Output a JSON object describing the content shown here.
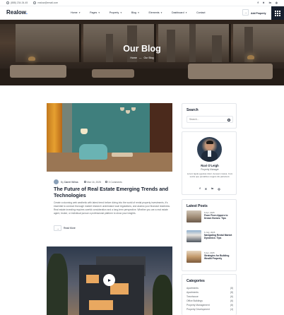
{
  "topbar": {
    "phone": "(888) 234-34-45",
    "email": "realow@email.com",
    "socials": [
      "f",
      "✕",
      "in",
      "◎"
    ]
  },
  "header": {
    "logo": "Realow",
    "logo_dot": ".",
    "nav": [
      {
        "label": "Home",
        "has_dropdown": true
      },
      {
        "label": "Pages",
        "has_dropdown": true
      },
      {
        "label": "Property",
        "has_dropdown": true
      },
      {
        "label": "Blog",
        "has_dropdown": true
      },
      {
        "label": "Elements",
        "has_dropdown": true
      },
      {
        "label": "Dashboard",
        "has_dropdown": true
      },
      {
        "label": "Contact",
        "has_dropdown": false
      }
    ],
    "login_icon": "→",
    "add_property": "Add Property"
  },
  "hero": {
    "title": "Our Blog",
    "crumb_home": "Home",
    "crumb_sep": "—",
    "crumb_current": "Our Blog"
  },
  "post": {
    "by": "By",
    "author": "Darrel Wilma",
    "date": "Mar 16, 2025",
    "comments": "3 Comments",
    "title": "The Future of Real Estate Emerging Trends and Technologies",
    "excerpt": "Create a stunning web aesthetic with latest trend before diving into the world of rental property investments, it's essential to conduct thorough market research understand local regulations, and assess your financial readiness. Real estate investing requires careful consideration and a long-term perspective. Whether you are a real estate agent, broker, or individual pursue a professional platform to show your insights.",
    "read_more": "Read More",
    "read_more_icon": "→"
  },
  "sidebar": {
    "search_title": "Search",
    "search_placeholder": "Search...",
    "profile_name": "Ravi O'Leigh",
    "profile_role": "Property Manager",
    "profile_bio": "Lorem ligula egestas dolor. Aenean massa. Cum sociis que penatibus magnis dis parturient.",
    "profile_socials": [
      "f",
      "✕",
      "in",
      "◎"
    ],
    "recent_title": "Latest Posts",
    "recent_posts": [
      {
        "date": "6 Apr, 2025",
        "title": "From Fixer-Uppers to Dream Homes: Tips"
      },
      {
        "date": "6 July, 2025",
        "title": "Navigating Rental Market Dynamics: Tips"
      },
      {
        "date": "6 Apr, 2025",
        "title": "Strategies for Building Wealth Property"
      }
    ],
    "categories_title": "Categories",
    "categories": [
      {
        "label": "Apartments",
        "count": "(8)"
      },
      {
        "label": "Apartments",
        "count": "(8)"
      },
      {
        "label": "Townhouse",
        "count": "(6)"
      },
      {
        "label": "Office Buildings",
        "count": "(6)"
      },
      {
        "label": "Property Management",
        "count": "(8)"
      },
      {
        "label": "Property Development",
        "count": "(4)"
      }
    ]
  }
}
